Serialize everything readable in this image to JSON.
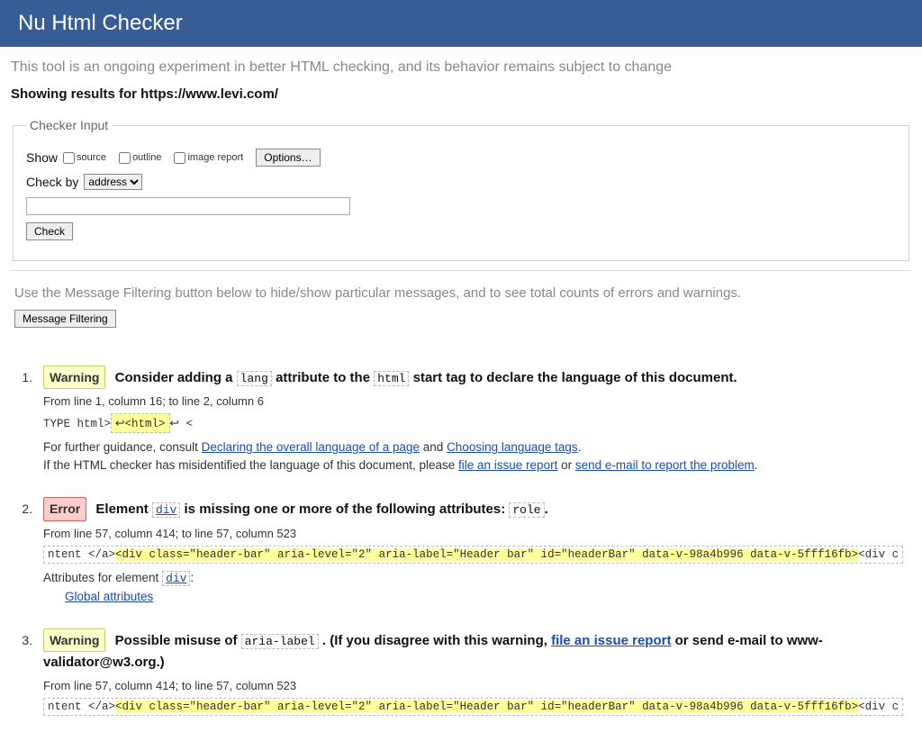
{
  "header": {
    "title": "Nu Html Checker"
  },
  "intro": "This tool is an ongoing experiment in better HTML checking, and its behavior remains subject to change",
  "results_for": "Showing results for https://www.levi.com/",
  "checker_input": {
    "legend": "Checker Input",
    "show_label": "Show",
    "source_label": "source",
    "outline_label": "outline",
    "image_report_label": "image report",
    "options_label": "Options…",
    "check_by_label": "Check by",
    "check_by_value": "address",
    "address_value": "",
    "check_button": "Check"
  },
  "filter_note": "Use the Message Filtering button below to hide/show particular messages, and to see total counts of errors and warnings.",
  "filter_button": "Message Filtering",
  "msg1": {
    "badge": "Warning",
    "h_pre": "Consider adding a ",
    "h_code1": "lang",
    "h_mid": " attribute to the ",
    "h_code2": "html",
    "h_post": " start tag to declare the language of this document.",
    "location": "From line 1, column 16; to line 2, column 6",
    "extract_plain1": "TYPE html>",
    "extract_hl": "↩<html>",
    "extract_plain2": "↩     <",
    "info1_pre": "For further guidance, consult ",
    "info1_link1": "Declaring the overall language of a page",
    "info1_mid": " and ",
    "info1_link2": "Choosing language tags",
    "info1_post": ".",
    "info2_pre": "If the HTML checker has misidentified the language of this document, please ",
    "info2_link1": "file an issue report",
    "info2_mid": " or ",
    "info2_link2": "send e-mail to report the problem",
    "info2_post": "."
  },
  "msg2": {
    "badge": "Error",
    "h_pre": "Element ",
    "h_code1": "div",
    "h_mid": " is missing one or more of the following attributes: ",
    "h_code2": "role",
    "h_post": ".",
    "location": "From line 57, column 414; to line 57, column 523",
    "extract_plain1": "ntent </a>",
    "extract_hl": "<div class=\"header-bar\" aria-level=\"2\" aria-label=\"Header bar\" id=\"headerBar\" data-v-98a4b996 data-v-5fff16fb>",
    "extract_plain2": "<div c",
    "info1_pre": "Attributes for element ",
    "info1_link": "div",
    "info1_post": ":",
    "info2_link": "Global attributes"
  },
  "msg3": {
    "badge": "Warning",
    "h_pre": "Possible misuse of ",
    "h_code1": "aria-label",
    "h_mid": ". (If you disagree with this warning, ",
    "h_link": "file an issue report",
    "h_post": " or send e-mail to www-validator@w3.org.)",
    "location": "From line 57, column 414; to line 57, column 523",
    "extract_plain1": "ntent </a>",
    "extract_hl": "<div class=\"header-bar\" aria-level=\"2\" aria-label=\"Header bar\" id=\"headerBar\" data-v-98a4b996 data-v-5fff16fb>",
    "extract_plain2": "<div c"
  }
}
